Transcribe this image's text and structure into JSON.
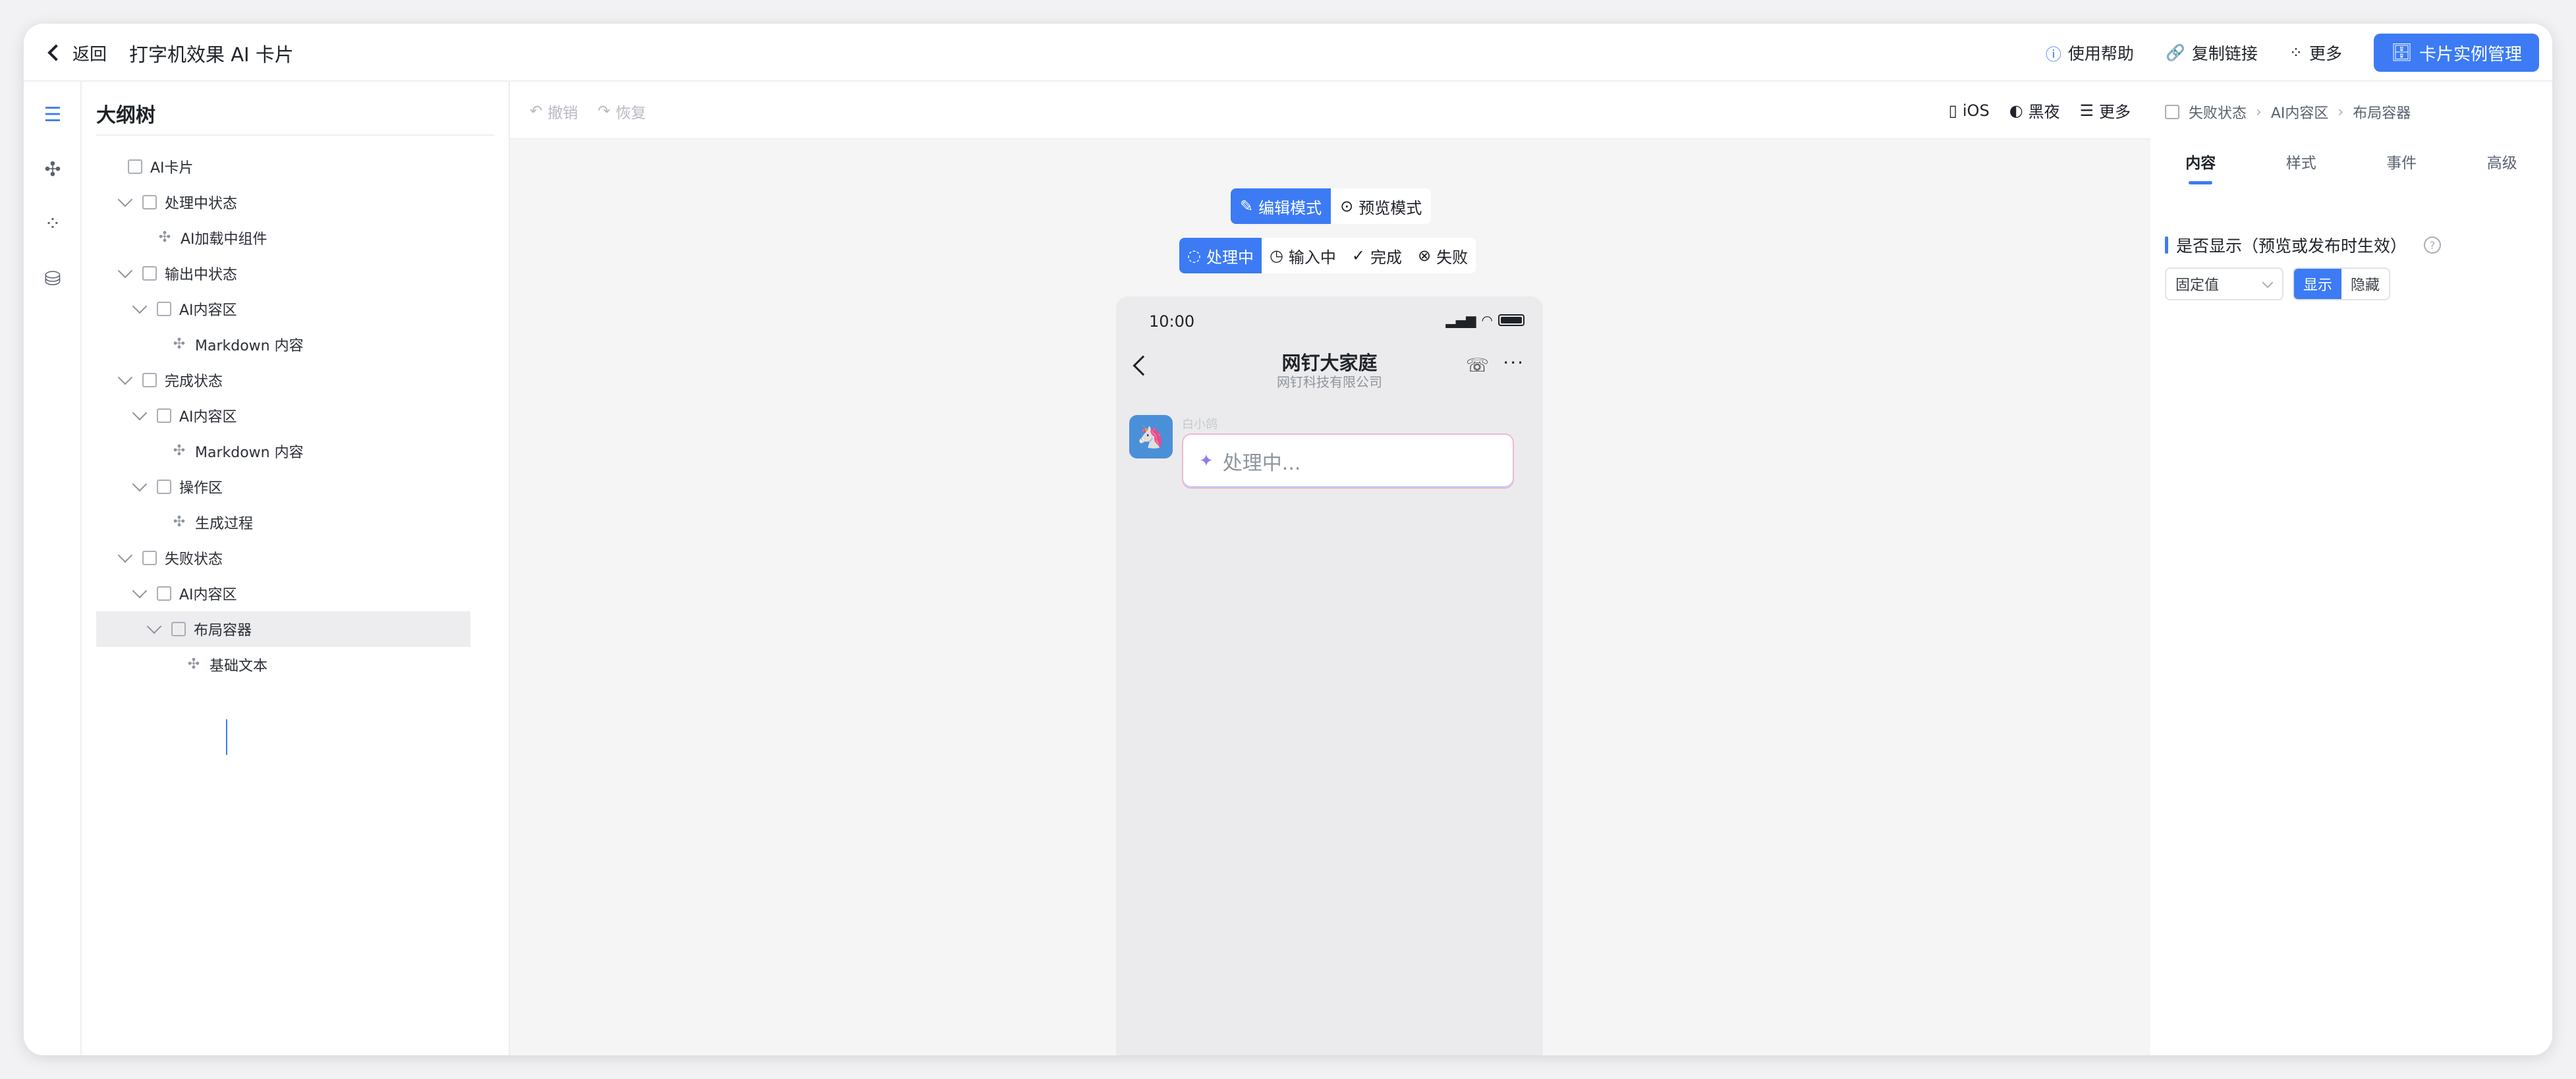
{
  "header": {
    "back_label": "返回",
    "title": "打字机效果 AI 卡片",
    "help_label": "使用帮助",
    "copy_link_label": "复制链接",
    "more_label": "更多",
    "manage_label": "卡片实例管理"
  },
  "rail": {
    "icons": [
      "outline-tree-icon",
      "component-puzzle-icon",
      "apps-grid-icon",
      "database-icon"
    ]
  },
  "outline": {
    "title": "大纲树",
    "nodes": [
      {
        "label": "AI卡片",
        "type": "container",
        "depth": 0,
        "caret": false
      },
      {
        "label": "处理中状态",
        "type": "container",
        "depth": 1,
        "caret": true
      },
      {
        "label": "AI加载中组件",
        "type": "component",
        "depth": 2,
        "caret": false
      },
      {
        "label": "输出中状态",
        "type": "container",
        "depth": 1,
        "caret": true
      },
      {
        "label": "AI内容区",
        "type": "container",
        "depth": 2,
        "caret": true
      },
      {
        "label": "Markdown 内容",
        "type": "component",
        "depth": 3,
        "caret": false
      },
      {
        "label": "完成状态",
        "type": "container",
        "depth": 1,
        "caret": true
      },
      {
        "label": "AI内容区",
        "type": "container",
        "depth": 2,
        "caret": true
      },
      {
        "label": "Markdown 内容",
        "type": "component",
        "depth": 3,
        "caret": false
      },
      {
        "label": "操作区",
        "type": "container",
        "depth": 2,
        "caret": true
      },
      {
        "label": "生成过程",
        "type": "component",
        "depth": 3,
        "caret": false
      },
      {
        "label": "失败状态",
        "type": "container",
        "depth": 1,
        "caret": true
      },
      {
        "label": "AI内容区",
        "type": "container",
        "depth": 2,
        "caret": true
      },
      {
        "label": "布局容器",
        "type": "container",
        "depth": 3,
        "caret": true,
        "selected": true
      },
      {
        "label": "基础文本",
        "type": "component",
        "depth": 4,
        "caret": false
      }
    ]
  },
  "canvas": {
    "undo_label": "撤销",
    "redo_label": "恢复",
    "platform_label": "iOS",
    "dark_label": "黑夜",
    "more_label": "更多",
    "edit_mode_label": "编辑模式",
    "preview_mode_label": "预览模式",
    "states": [
      {
        "label": "处理中",
        "active": true
      },
      {
        "label": "输入中",
        "active": false
      },
      {
        "label": "完成",
        "active": false
      },
      {
        "label": "失败",
        "active": false
      }
    ]
  },
  "phone": {
    "time": "10:00",
    "chat_title": "网钉大家庭",
    "chat_subtitle": "网钉科技有限公司",
    "bot_name": "白小鸽",
    "bubble_text": "处理中..."
  },
  "inspector": {
    "crumbs": [
      "失败状态",
      "AI内容区",
      "布局容器"
    ],
    "tabs": [
      {
        "label": "内容",
        "active": true
      },
      {
        "label": "样式",
        "active": false
      },
      {
        "label": "事件",
        "active": false
      },
      {
        "label": "高级",
        "active": false
      }
    ],
    "visibility_label": "是否显示（预览或发布时生效）",
    "value_mode": "固定值",
    "show_label": "显示",
    "hide_label": "隐藏"
  },
  "colors": {
    "accent": "#3c7bf4",
    "selected_row": "#ededf0"
  }
}
